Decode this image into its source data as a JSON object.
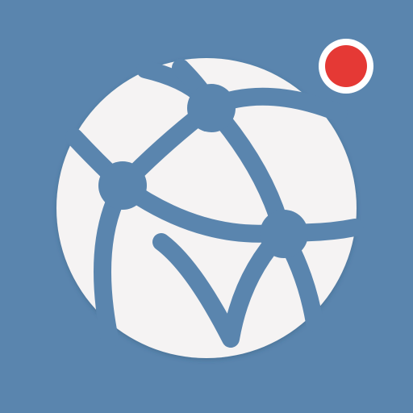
{
  "app_icon": {
    "icon_name": "network-globe-icon",
    "badge_icon": "notification-dot-icon",
    "colors": {
      "background": "#5A85AE",
      "globe": "#F5F3F3",
      "mesh_lines": "#5A85AE",
      "badge": "#E53935",
      "badge_ring": "#FFFFFF"
    }
  }
}
